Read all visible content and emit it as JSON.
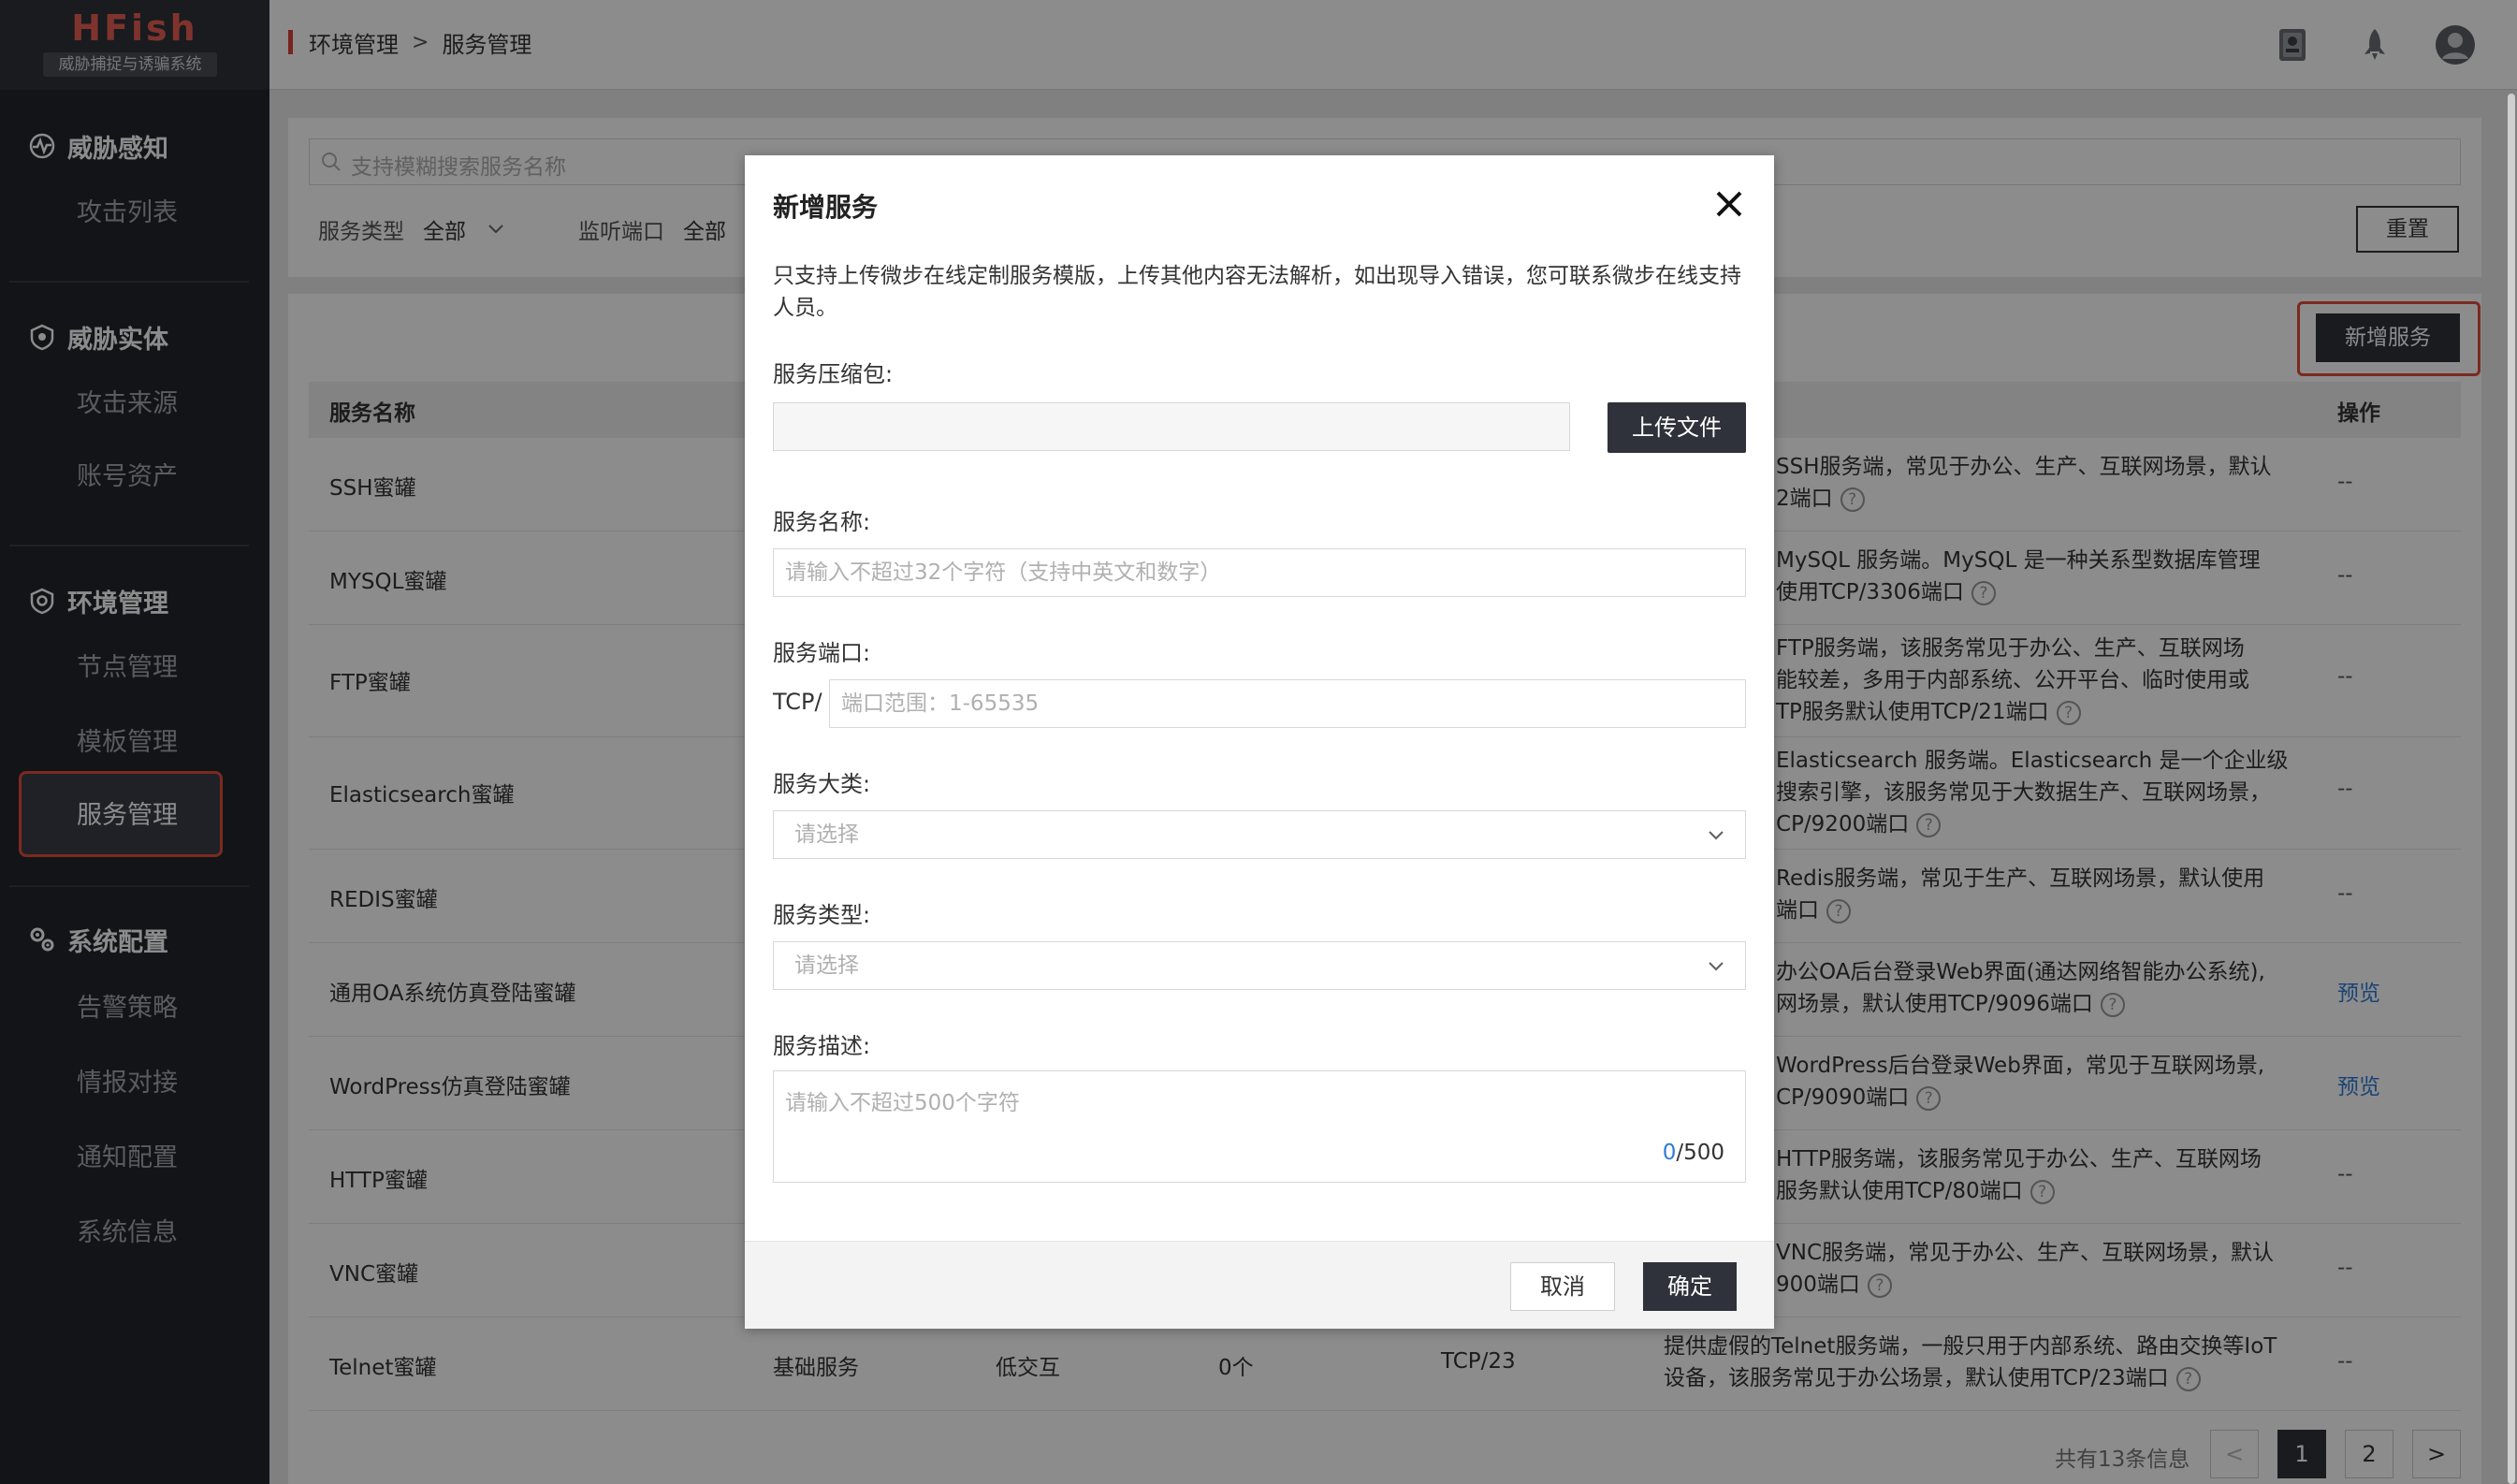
{
  "brand": {
    "name": "HFish",
    "tagline": "威胁捕捉与诱骗系统"
  },
  "sidebar": {
    "groups": [
      {
        "title": "威胁感知",
        "icon": "radar-icon",
        "items": [
          "攻击列表"
        ]
      },
      {
        "title": "威胁实体",
        "icon": "shield-icon",
        "items": [
          "攻击来源",
          "账号资产"
        ]
      },
      {
        "title": "环境管理",
        "icon": "settings-shield-icon",
        "items": [
          "节点管理",
          "模板管理",
          "服务管理"
        ]
      },
      {
        "title": "系统配置",
        "icon": "gears-icon",
        "items": [
          "告警策略",
          "情报对接",
          "通知配置",
          "系统信息"
        ]
      }
    ],
    "active_item": "服务管理"
  },
  "breadcrumb": {
    "parent": "环境管理",
    "sep": ">",
    "current": "服务管理"
  },
  "topbar_icons": [
    "notebook-icon",
    "rocket-icon",
    "user-avatar-icon"
  ],
  "search": {
    "placeholder": "支持模糊搜索服务名称"
  },
  "filters": {
    "type_label": "服务类型",
    "type_value": "全部",
    "port_label": "监听端口",
    "port_value": "全部"
  },
  "reset_label": "重置",
  "add_service_label": "新增服务",
  "table": {
    "col_name": "服务名称",
    "col_op": "操作",
    "rows": [
      {
        "name": "SSH蜜罐",
        "desc1": "SSH服务端，常见于办公、生产、互联网场景，默认",
        "desc2": "2端口",
        "op": "--"
      },
      {
        "name": "MYSQL蜜罐",
        "desc1": " MySQL 服务端。MySQL 是一种关系型数据库管理",
        "desc2": "使用TCP/3306端口",
        "op": "--"
      },
      {
        "name": "FTP蜜罐",
        "desc1": "FTP服务端，该服务常见于办公、生产、互联网场",
        "desc2": "能较差，多用于内部系统、公开平台、临时使用或",
        "desc3": "TP服务默认使用TCP/21端口",
        "op": "--"
      },
      {
        "name": "Elasticsearch蜜罐",
        "desc1": " Elasticsearch 服务端。Elasticsearch 是一个企业级",
        "desc2": "搜索引擎，该服务常见于大数据生产、互联网场景，",
        "desc3": "CP/9200端口",
        "op": "--"
      },
      {
        "name": "REDIS蜜罐",
        "desc1": "Redis服务端，常见于生产、互联网场景，默认使用",
        "desc2": "端口",
        "op": "--"
      },
      {
        "name": "通用OA系统仿真登陆蜜罐",
        "desc1": "办公OA后台登录Web界面(通达网络智能办公系统),",
        "desc2": "网场景，默认使用TCP/9096端口",
        "op": "预览"
      },
      {
        "name": "WordPress仿真登陆蜜罐",
        "desc1": "WordPress后台登录Web界面，常见于互联网场景,",
        "desc2": "CP/9090端口",
        "op": "预览"
      },
      {
        "name": "HTTP蜜罐",
        "desc1": "HTTP服务端，该服务常见于办公、生产、互联网场",
        "desc2": "服务默认使用TCP/80端口",
        "op": "--"
      },
      {
        "name": "VNC蜜罐",
        "desc1": "VNC服务端，常见于办公、生产、互联网场景，默认",
        "desc2": "900端口",
        "op": "--"
      },
      {
        "name": "Telnet蜜罐",
        "category": "基础服务",
        "interaction": "低交互",
        "count": "0个",
        "port": "TCP/23",
        "desc1": "提供虚假的Telnet服务端，一般只用于内部系统、路由交换等IoT",
        "desc2": "设备，该服务常见于办公场景，默认使用TCP/23端口",
        "op": "--"
      }
    ]
  },
  "pagination": {
    "summary": "共有13条信息",
    "prev": "<",
    "pages": [
      "1",
      "2"
    ],
    "next": ">",
    "current": "1"
  },
  "modal": {
    "title": "新增服务",
    "notice": "只支持上传微步在线定制服务模版，上传其他内容无法解析，如出现导入错误，您可联系微步在线支持人员。",
    "package_label": "服务压缩包:",
    "upload_label": "上传文件",
    "name_label": "服务名称:",
    "name_placeholder": "请输入不超过32个字符（支持中英文和数字）",
    "port_label": "服务端口:",
    "port_prefix": "TCP/",
    "port_placeholder": "端口范围：1-65535",
    "category_label": "服务大类:",
    "category_placeholder": "请选择",
    "type_label": "服务类型:",
    "type_placeholder": "请选择",
    "desc_label": "服务描述:",
    "desc_placeholder": "请输入不超过500个字符",
    "desc_count": "0",
    "desc_max": "/500",
    "cancel_label": "取消",
    "ok_label": "确定"
  }
}
